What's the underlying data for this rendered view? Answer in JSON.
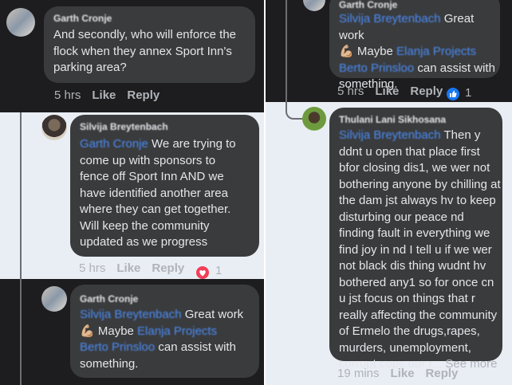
{
  "comments": {
    "c1": {
      "name": "Garth Cronje",
      "text": "And secondly, who will enforce the\nflock when they annex Sport Inn's\nparking area?",
      "time": "5 hrs",
      "like": "Like",
      "reply": "Reply"
    },
    "c2": {
      "name": "Silvija Breytenbach",
      "mention": "Garth Cronje",
      "line1_rest": " We are trying to",
      "text_rest": "come up with sponsors to\nfence off Sport Inn AND we\nhave identified another area\nwhere they can get together.\nWill keep the community\nupdated as we progress",
      "time": "5 hrs",
      "like": "Like",
      "reply": "Reply",
      "reaction": "love",
      "reaction_count": "1"
    },
    "c3": {
      "name": "Garth Cronje",
      "mention1": "Silvija Breytenbach",
      "line1_rest": " Great work",
      "emoji": "💪🏼",
      "maybe": " Maybe ",
      "mention2": "Elanja Projects",
      "mention3": "Berto Prinsloo",
      "line3_rest": " can assist with",
      "line4": "something."
    },
    "c4": {
      "name": "Garth Cronje",
      "mention1": "Silvija Breytenbach",
      "line1_rest": " Great work",
      "emoji": "💪🏼",
      "maybe": " Maybe ",
      "mention2": "Elanja Projects",
      "mention3": "Berto Prinsloo",
      "line3_rest": " can assist with",
      "line4": "something.",
      "time": "5 hrs",
      "like": "Like",
      "reply": "Reply",
      "reaction": "like",
      "reaction_count": "1"
    },
    "c5": {
      "name": "Thulani Lani Sikhosana",
      "mention": "Silvija Breytenbach",
      "line1_rest": " Then y",
      "text_rest": "ddnt u open that place first\nbfor closing dis1, we wer not\nbothering anyone by chilling at\nthe dam jst always hv to keep\ndisturbing our peace nd\nfinding fault in everything we\nfind joy in nd I tell u if we wer\nnot black dis thing wudnt hv\nbothered any1 so for once cn\nu jst focus on things that r\nreally affecting the community\nof Ermelo the drugs,rapes,\nmurders, unemployment,\ncorrupt cops our r...",
      "see_more": " See more",
      "time": "19 mins",
      "like": "Like",
      "reply": "Reply"
    }
  },
  "colors": {
    "mention": "#4b8df7",
    "bubble": "#3a3b3c",
    "dark_bg": "#1d1d1f",
    "light_bg": "#e9eef5",
    "love": "#f33e58",
    "like": "#1877f2"
  }
}
